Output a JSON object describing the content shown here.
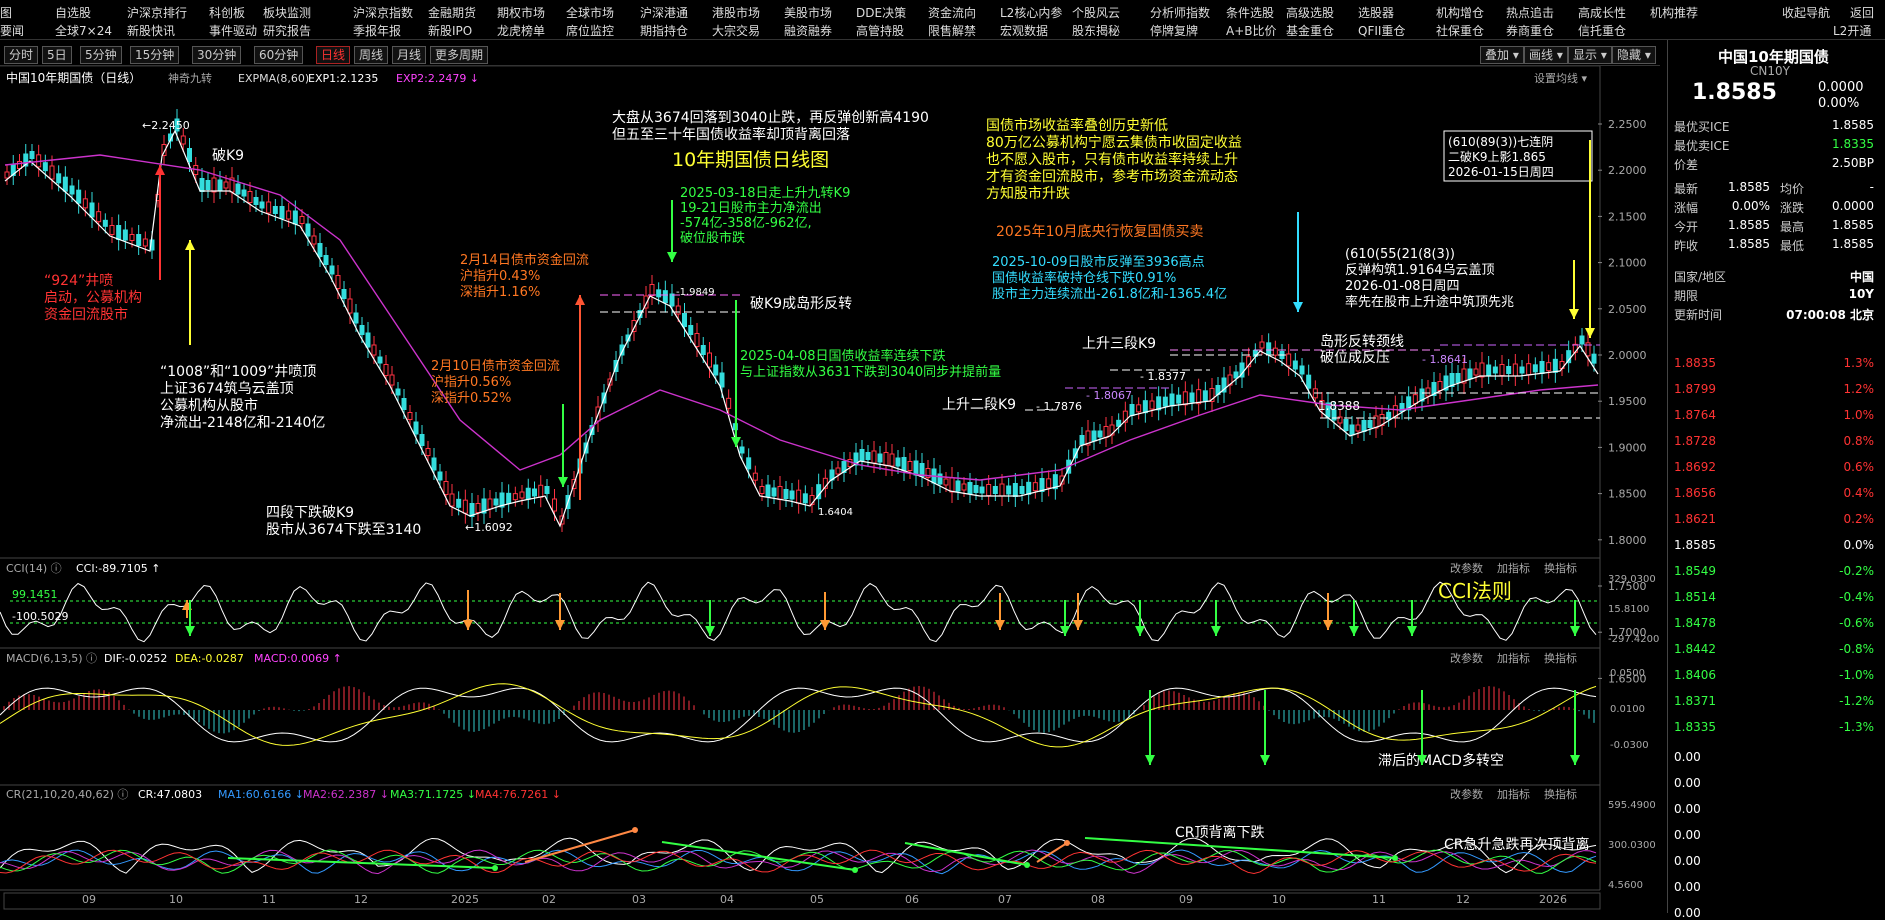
{
  "top_menu": {
    "row1": [
      "图",
      "自选股",
      "沪深京排行",
      "科创板",
      "板块监测",
      "沪深京指数",
      "金融期货",
      "期权市场",
      "全球市场",
      "沪深港通",
      "港股市场",
      "美股市场",
      "DDE决策",
      "资金流向",
      "L2核心内参",
      "个股风云",
      "分析师指数",
      "条件选股",
      "高级选股",
      "选股器",
      "机构增仓",
      "热点追击",
      "高成长性",
      "机构推荐",
      "收起导航",
      "返回"
    ],
    "row2": [
      "要闻",
      "全球7×24",
      "新股快讯",
      "事件驱动",
      "研究报告",
      "季报年报",
      "新股IPO",
      "龙虎榜单",
      "席位监控",
      "期指持仓",
      "大宗交易",
      "融资融券",
      "高管持股",
      "限售解禁",
      "宏观数据",
      "股东揭秘",
      "停牌复牌",
      "A+B比价",
      "基金重仓",
      "QFII重仓",
      "社保重仓",
      "券商重仓",
      "信托重仓",
      "L2开通"
    ]
  },
  "toolbar": {
    "periods": [
      "分时",
      "5日",
      "5分钟",
      "15分钟",
      "30分钟",
      "60分钟",
      "日线",
      "周线",
      "月线",
      "更多周期"
    ],
    "active": "日线",
    "right": [
      "叠加",
      "画线",
      "显示",
      "隐藏"
    ]
  },
  "main": {
    "title": "中国10年期国债（日线）",
    "indicator": "神奇九转",
    "expma": "EXPMA(8,60)",
    "exp1": "EXP1:2.1235",
    "exp2": "EXP2:2.2479",
    "settings": "设置均线",
    "yaxis": [
      "2.2500",
      "2.2000",
      "2.1500",
      "2.1000",
      "2.0500",
      "2.0000",
      "1.9500",
      "1.9000",
      "1.8500",
      "1.8000",
      "1.7500",
      "1.7000",
      "1.6500"
    ],
    "annotations": {
      "a1": [
        "大盘从3674回落到3040止跌，再反弹创新高4190",
        "但五至三十年国债收益率却顶背离回落"
      ],
      "title": "10年期国债日线图",
      "a2": [
        "国债市场收益率叠创历史新低",
        "80万亿公募机构宁愿云集债市收固定收益",
        "也不愿入股市，只有债市收益率持续上升",
        "才有资金回流股市，参考市场资金流动态",
        "方知股市升跌"
      ],
      "a3": [
        "2025-03-18日走上升九转K9",
        "19-21日股市主力净流出",
        "-574亿-358亿-962亿,",
        "破位股市跌"
      ],
      "a4": "2025年10月底央行恢复国债买卖",
      "a5": [
        "2025-10-09日股市反弹至3936高点",
        "国债收益率破持仓线下跌0.91%",
        "股市主力连续流出-261.8亿和-1365.4亿"
      ],
      "a6": [
        "2月14日债市资金回流",
        "沪指升0.43%",
        "深指升1.16%"
      ],
      "a7": [
        "2月10日债市资金回流",
        "沪指升0.56%",
        "深指升0.52%"
      ],
      "a8": [
        "2025-04-08日国债收益率连续下跌",
        "与上证指数从3631下跌到3040同步并提前量"
      ],
      "a9": [
        "“924”井喷",
        "启动，公募机构",
        "资金回流股市"
      ],
      "a10": [
        "“1008”和“1009”井喷顶",
        "上证3674筑乌云盖顶",
        "公募机构从股市",
        "净流出-2148亿和-2140亿"
      ],
      "a11": [
        "四段下跌破K9",
        "股市从3674下跌至3140"
      ],
      "a12": "破K9",
      "a13": "破K9成岛形反转",
      "a14": "上升三段K9",
      "a15": "上升二段K9",
      "a16": [
        "岛形反转颈线",
        "破位成反压"
      ],
      "a17": [
        "(610(55(21(8(3))",
        "反弹构筑1.9164乌云盖顶",
        "2026-01-08日周四",
        "率先在股市上升途中筑顶先兆"
      ],
      "box": [
        "(610(89(3))七连阴",
        "二破K9上影1.865",
        "2026-01-15日周四"
      ],
      "hi": "2.2450",
      "lo": "1.6092",
      "lv1": "1.7876",
      "lv2": "1.8067",
      "lv3": "1.8377",
      "lv4": "1.8388",
      "lv5": "1.8641",
      "lv6": "1.6404",
      "lv7": "1.9849"
    },
    "xaxis": [
      "09",
      "10",
      "11",
      "12",
      "2025",
      "02",
      "03",
      "04",
      "05",
      "06",
      "07",
      "08",
      "09",
      "10",
      "11",
      "12",
      "2026"
    ]
  },
  "cci": {
    "label": "CCI(14)",
    "value": "CCI:-89.7105",
    "l1": "99.1451",
    "l2": "-100.5029",
    "y": [
      "329.0300",
      "15.8100",
      "-297.4200"
    ],
    "note": "CCI法则",
    "btns": [
      "改参数",
      "加指标",
      "换指标"
    ]
  },
  "macd": {
    "label": "MACD(6,13,5)",
    "dif": "DIF:-0.0252",
    "dea": "DEA:-0.0287",
    "macd": "MACD:0.0069",
    "y": [
      "0.0500",
      "0.0100",
      "-0.0300"
    ],
    "note": "滞后的MACD多转空",
    "btns": [
      "改参数",
      "加指标",
      "换指标"
    ]
  },
  "cr": {
    "label": "CR(21,10,20,40,62)",
    "cr": "CR:47.0803",
    "ma1": "MA1:60.6166",
    "ma2": "MA2:62.2387",
    "ma3": "MA3:71.1725",
    "ma4": "MA4:76.7261",
    "y": [
      "595.4900",
      "300.0300",
      "4.5600"
    ],
    "n1": "CR顶背离下跌",
    "n2": "CR急升急跌再次顶背离",
    "btns": [
      "改参数",
      "加指标",
      "换指标"
    ]
  },
  "quote": {
    "name": "中国10年期国债",
    "code": "CN10Y",
    "price": "1.8585",
    "chg": "0.0000",
    "pct": "0.00%",
    "rows": [
      [
        "最优买ICE",
        "1.8585"
      ],
      [
        "最优卖ICE",
        "1.8335"
      ],
      [
        "价差",
        "2.50BP"
      ]
    ],
    "grid": [
      [
        "最新",
        "1.8585",
        "均价",
        "-"
      ],
      [
        "涨幅",
        "0.00%",
        "涨跌",
        "0.0000"
      ],
      [
        "今开",
        "1.8585",
        "最高",
        "1.8585"
      ],
      [
        "昨收",
        "1.8585",
        "最低",
        "1.8585"
      ]
    ],
    "region": [
      "国家/地区",
      "中国"
    ],
    "period": [
      "期限",
      "10Y"
    ],
    "time": [
      "更新时间",
      "07:00:08 北京"
    ],
    "ladder": [
      [
        "1.8835",
        "1.3%"
      ],
      [
        "1.8799",
        "1.2%"
      ],
      [
        "1.8764",
        "1.0%"
      ],
      [
        "1.8728",
        "0.8%"
      ],
      [
        "1.8692",
        "0.6%"
      ],
      [
        "1.8656",
        "0.4%"
      ],
      [
        "1.8621",
        "0.2%"
      ],
      [
        "1.8585",
        "0.0%"
      ],
      [
        "1.8549",
        "-0.2%"
      ],
      [
        "1.8514",
        "-0.4%"
      ],
      [
        "1.8478",
        "-0.6%"
      ],
      [
        "1.8442",
        "-0.8%"
      ],
      [
        "1.8406",
        "-1.0%"
      ],
      [
        "1.8371",
        "-1.2%"
      ],
      [
        "1.8335",
        "-1.3%"
      ]
    ],
    "zeros": [
      "0.00",
      "0.00",
      "0.00",
      "0.00",
      "0.00",
      "0.00",
      "0.00"
    ]
  }
}
